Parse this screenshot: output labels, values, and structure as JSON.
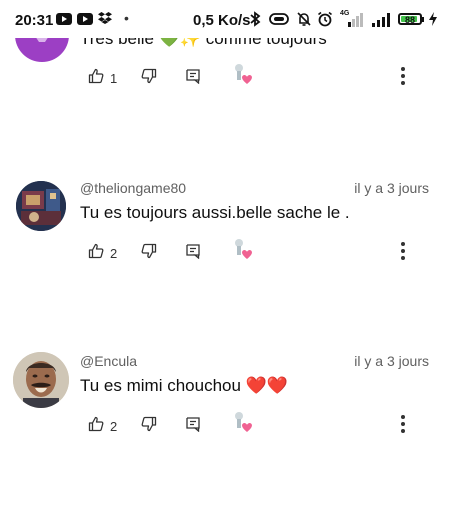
{
  "status_bar": {
    "time": "20:31",
    "network_speed": "0,5 Ko/s",
    "signal_label": "4G",
    "battery": "88",
    "battery_level": 0.88,
    "icons": [
      "youtube-icon",
      "youtube-icon",
      "dropbox-icon",
      "dot",
      "bluetooth-icon",
      "vibrate-icon",
      "alarm-off-icon",
      "alarm-icon",
      "signal-4g-icon",
      "signal-icon",
      "battery-icon",
      "charging-icon"
    ]
  },
  "colors": {
    "meta_text": "#606060",
    "body_text": "#0f0f0f",
    "heart": "#f06292",
    "battery_fill": "#43c34b",
    "top_avatar": "#9c3fc4"
  },
  "comments": [
    {
      "text": "Très belle 💚✨ comme toujours",
      "likes": "1",
      "icons": [
        "like-icon",
        "dislike-icon",
        "reply-icon",
        "creator-heart-icon",
        "more-icon"
      ]
    },
    {
      "author": "@theliongame80",
      "time": "il y a 3 jours",
      "text": "Tu es toujours aussi.belle sache le .",
      "likes": "2"
    },
    {
      "author": "@Encula",
      "time": "il y a 3 jours",
      "text": "Tu es mimi chouchou ❤️❤️",
      "likes": "2"
    }
  ]
}
